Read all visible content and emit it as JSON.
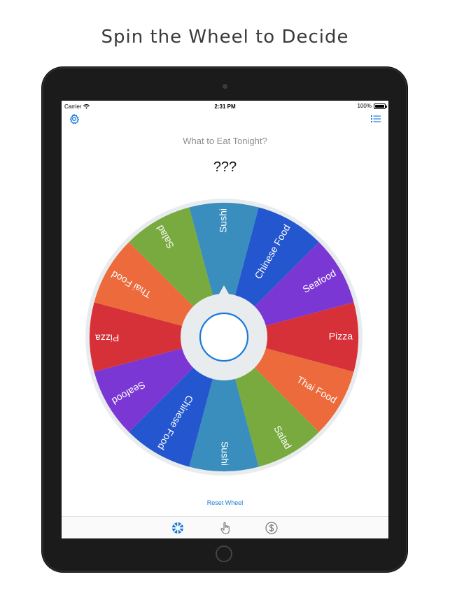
{
  "headline": "Spin the Wheel to Decide",
  "status_bar": {
    "carrier": "Carrier",
    "time": "2:31 PM",
    "battery": "100%"
  },
  "header": {
    "settings_icon": "gear-icon",
    "list_icon": "list-icon"
  },
  "question": "What to Eat Tonight?",
  "result": "???",
  "wheel": {
    "segments": [
      {
        "label": "Sushi",
        "color": "#3a8ebd"
      },
      {
        "label": "Chinese Food",
        "color": "#2456cf"
      },
      {
        "label": "Seafood",
        "color": "#7b37d4"
      },
      {
        "label": "Pizza",
        "color": "#d63139"
      },
      {
        "label": "Thai Food",
        "color": "#ec6a3b"
      },
      {
        "label": "Salad",
        "color": "#78aa3f"
      },
      {
        "label": "Sushi",
        "color": "#3a8ebd"
      },
      {
        "label": "Chinese Food",
        "color": "#2456cf"
      },
      {
        "label": "Seafood",
        "color": "#7b37d4"
      },
      {
        "label": "Pizza",
        "color": "#d63139"
      },
      {
        "label": "Thai Food",
        "color": "#ec6a3b"
      },
      {
        "label": "Salad",
        "color": "#78aa3f"
      }
    ],
    "rim_color": "#e9ecef",
    "hub_color": "#e9ecef",
    "spin_button_color": "#1a7bd8"
  },
  "reset_label": "Reset Wheel",
  "tabs": [
    {
      "icon": "wheel-icon",
      "active": true
    },
    {
      "icon": "tap-hand-icon",
      "active": false
    },
    {
      "icon": "dollar-icon",
      "active": false
    }
  ],
  "accent_color": "#1a7bd8"
}
